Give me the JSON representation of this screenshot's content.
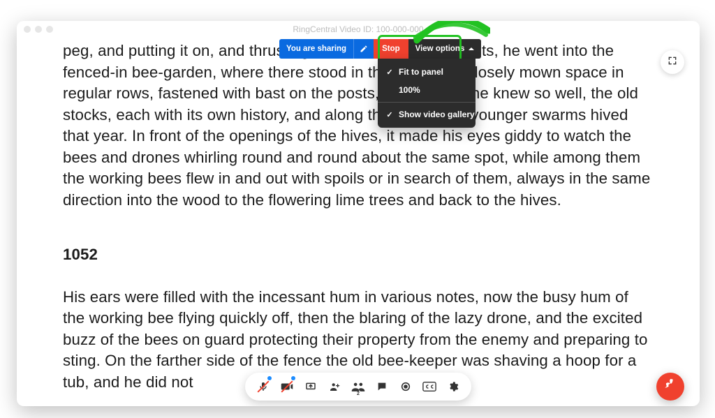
{
  "title": "RingCentral Video ID: 100-000-000",
  "paragraphs": {
    "p1": "peg, and putting it on, and thrusting his hands into his pockets, he went into the fenced-in bee-garden, where there stood in the midst of a closely mown space in regular rows, fastened with bast on the posts, all the hives he knew so well, the old stocks, each with its own history, and along the fences the younger swarms hived that year. In front of the openings of the hives, it made his eyes giddy to watch the bees and drones whirling round and round about the same spot, while among them the working bees flew in and out with spoils or in search of them, always in the same direction into the wood to the flowering lime trees and back to the hives.",
    "pagenum": "1052",
    "p2": "His ears were filled with the incessant hum in various notes, now the busy hum of the working bee flying quickly off, then the blaring of the lazy drone, and the excited buzz of the bees on guard protecting their property from the enemy and preparing to sting. On the farther side of the fence the old bee-keeper was shaving a hoop for a tub, and he did not"
  },
  "share_bar": {
    "sharing_label": "You are sharing",
    "stop_label": "Stop",
    "view_label": "View options"
  },
  "dropdown": {
    "fit": "Fit to panel",
    "hundred": "100%",
    "gallery": "Show video gallery"
  },
  "tray": {
    "participants_count": "2"
  }
}
